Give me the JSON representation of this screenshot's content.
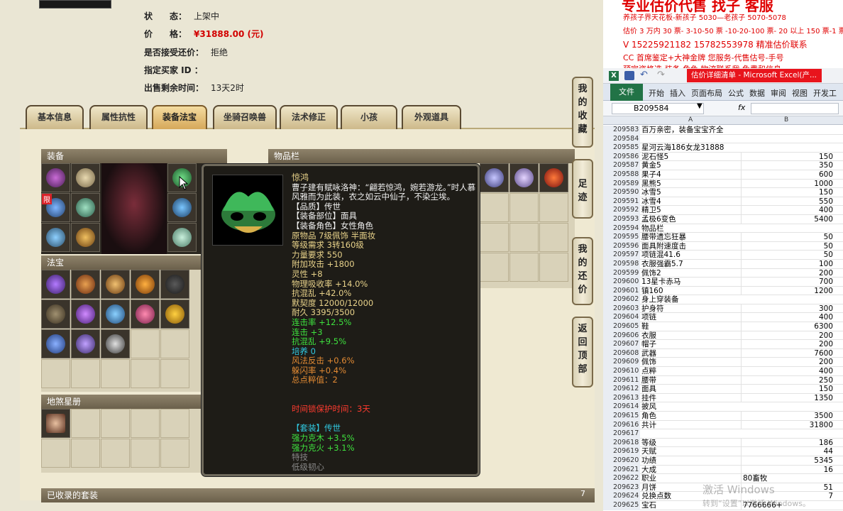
{
  "listing": {
    "status": {
      "label": "状　　态：",
      "value": "上架中"
    },
    "price": {
      "label": "价　　格：",
      "value": "¥31888.00 (元)"
    },
    "counter_offer": {
      "label": "是否接受还价：",
      "value": "拒绝"
    },
    "buyer_id": {
      "label": "指定买家 ID ：",
      "value": ""
    },
    "remaining": {
      "label": "出售剩余时间：",
      "value": "13天2时"
    }
  },
  "tabs": [
    "基本信息",
    "属性抗性",
    "装备法宝",
    "坐骑召唤兽",
    "法术修正",
    "小孩",
    "外观道具"
  ],
  "active_tab": "装备法宝",
  "sections": {
    "equipment": "装备",
    "inventory": "物品栏",
    "treasure": "法宝",
    "tianshu": "地煞星册",
    "collected_sets": "已收录的套装",
    "collected_count": "7"
  },
  "side_buttons": [
    {
      "text": "我的收藏"
    },
    {
      "text": "足迹"
    },
    {
      "text": "我的还价"
    },
    {
      "text": "返回顶部"
    }
  ],
  "badge_limited": "限",
  "tooltip": {
    "name": "惊鸿",
    "desc": "曹子建有赋咏洛神：“翩若惊鸿，婉若游龙。”时人慕风雅而为此装，衣之如云中仙子，不染尘埃。",
    "lines": [
      {
        "text": "【品质】传世",
        "color": "white"
      },
      {
        "text": "【装备部位】面具",
        "color": "white"
      },
      {
        "text": "【装备角色】女性角色",
        "color": "white"
      },
      {
        "text": "原物品 7级佩饰 半面妆",
        "color": "yellow"
      },
      {
        "text": "等级需求 3转160级",
        "color": "yellow"
      },
      {
        "text": "力量要求 550",
        "color": "yellow"
      },
      {
        "text": "附加攻击 +1800",
        "color": "yellow"
      },
      {
        "text": "灵性 +8",
        "color": "yellow"
      },
      {
        "text": "物理吸收率 +14.0%",
        "color": "yellow"
      },
      {
        "text": "抗混乱 +42.0%",
        "color": "yellow"
      },
      {
        "text": "默契度 12000/12000",
        "color": "yellow"
      },
      {
        "text": "耐久 3395/3500",
        "color": "yellow"
      },
      {
        "text": "连击率 +12.5%",
        "color": "green"
      },
      {
        "text": "连击 +3",
        "color": "green"
      },
      {
        "text": "抗混乱 +9.5%",
        "color": "green"
      },
      {
        "text": "培养 0",
        "color": "cyan"
      },
      {
        "text": "风法反击 +0.6%",
        "color": "orange"
      },
      {
        "text": "躲闪率 +0.4%",
        "color": "orange"
      },
      {
        "text": "总点粹值：2",
        "color": "orange"
      },
      {
        "text": "",
        "color": "white"
      },
      {
        "text": "",
        "color": "white"
      },
      {
        "text": "时间锁保护时间：3天",
        "color": "red"
      },
      {
        "text": "",
        "color": "white"
      },
      {
        "text": "【套装】传世",
        "color": "cyan"
      },
      {
        "text": "强力克木 +3.5%",
        "color": "green"
      },
      {
        "text": "强力克火 +3.1%",
        "color": "green"
      },
      {
        "text": "特技",
        "color": "gray"
      },
      {
        "text": "低级韧心",
        "color": "gray"
      }
    ]
  },
  "excel_header_text": [
    "专业估价代售 找子 客服",
    "养孩子界天花板-新孩子 5030—老孩子 5070-5078",
    "估价 3 万内 30 票- 3-10-50 票 -10-20-100 票- 20 以上 150 票-1 票",
    "V 15225921182   15782553978  精准估价联系",
    "CC 首席鉴定+大神金牌  您服务-代售估号-手号",
    "预定资格选 装备 角色 物流联系我 免费和信息"
  ],
  "excel": {
    "window_title": "估价详细清单 - Microsoft Excel(产...",
    "file_tab": "文件",
    "ribbon_tabs": [
      "开始",
      "插入",
      "页面布局",
      "公式",
      "数据",
      "审阅",
      "视图",
      "开发工具"
    ],
    "name_box": "B209584",
    "fx": "fx",
    "col_a": "A",
    "col_b": "B",
    "rows": [
      {
        "n": "209583",
        "a": "百万亲密，装备宝宝齐全",
        "b": ""
      },
      {
        "n": "209584",
        "a": "",
        "b": ""
      },
      {
        "n": "209585",
        "a": "星河云海186女龙31888",
        "b": ""
      },
      {
        "n": "209586",
        "a": "泥石怪5",
        "b": "150"
      },
      {
        "n": "209587",
        "a": "黄金5",
        "b": "350"
      },
      {
        "n": "209588",
        "a": "果子4",
        "b": "600"
      },
      {
        "n": "209589",
        "a": "黑熊5",
        "b": "1000"
      },
      {
        "n": "209590",
        "a": "冰雪5",
        "b": "150"
      },
      {
        "n": "209591",
        "a": "冰雪4",
        "b": "550"
      },
      {
        "n": "209592",
        "a": "精卫5",
        "b": "400"
      },
      {
        "n": "209593",
        "a": "孟极6变色",
        "b": "5400"
      },
      {
        "n": "209594",
        "a": "物品栏",
        "b": ""
      },
      {
        "n": "209595",
        "a": "腰带遗忘狂暴",
        "b": "50"
      },
      {
        "n": "209596",
        "a": "面具附速度击",
        "b": "50"
      },
      {
        "n": "209597",
        "a": "项链混41.6",
        "b": "50"
      },
      {
        "n": "209598",
        "a": "衣服强霸5.7",
        "b": "100"
      },
      {
        "n": "209599",
        "a": "佩饰2",
        "b": "200"
      },
      {
        "n": "209600",
        "a": "13星卡赤马",
        "b": "700"
      },
      {
        "n": "209601",
        "a": "镇160",
        "b": "1200"
      },
      {
        "n": "209602",
        "a": "身上穿装备",
        "b": ""
      },
      {
        "n": "209603",
        "a": "护身符",
        "b": "300"
      },
      {
        "n": "209604",
        "a": "项链",
        "b": "400"
      },
      {
        "n": "209605",
        "a": "鞋",
        "b": "6300"
      },
      {
        "n": "209606",
        "a": "衣服",
        "b": "200"
      },
      {
        "n": "209607",
        "a": "帽子",
        "b": "200"
      },
      {
        "n": "209608",
        "a": "武器",
        "b": "7600"
      },
      {
        "n": "209609",
        "a": "佩饰",
        "b": "200"
      },
      {
        "n": "209610",
        "a": "点粹",
        "b": "400"
      },
      {
        "n": "209611",
        "a": "腰带",
        "b": "250"
      },
      {
        "n": "209612",
        "a": "面具",
        "b": "150"
      },
      {
        "n": "209613",
        "a": "挂件",
        "b": "1350"
      },
      {
        "n": "209614",
        "a": "披风",
        "b": ""
      },
      {
        "n": "209615",
        "a": "角色",
        "b": "3500"
      },
      {
        "n": "209616",
        "a": "共计",
        "b": "31800"
      },
      {
        "n": "209617",
        "a": "",
        "b": ""
      },
      {
        "n": "209618",
        "a": "等级",
        "b": "186"
      },
      {
        "n": "209619",
        "a": "天赋",
        "b": "44"
      },
      {
        "n": "209620",
        "a": "功绩",
        "b": "5345"
      },
      {
        "n": "209621",
        "a": "大成",
        "b": "16"
      },
      {
        "n": "209622",
        "a": "职业",
        "b": "80畜牧",
        "bl": true
      },
      {
        "n": "209623",
        "a": "月饼",
        "b": "51"
      },
      {
        "n": "209624",
        "a": "兑换点数",
        "b": "7"
      },
      {
        "n": "209625",
        "a": "宝石",
        "b": "7766666+",
        "bl": true
      }
    ]
  },
  "watermark": {
    "line1": "激活 Windows",
    "line2": "转到“设置”以激活 Windows。"
  },
  "colors": {
    "price_red": "#d20000",
    "tooltip_yellow": "#e8d28a",
    "tooltip_green": "#3ee03e",
    "tooltip_orange": "#e28a33",
    "tooltip_cyan": "#30c8e0",
    "excel_green": "#217346",
    "excel_red_title": "#e8141c"
  }
}
